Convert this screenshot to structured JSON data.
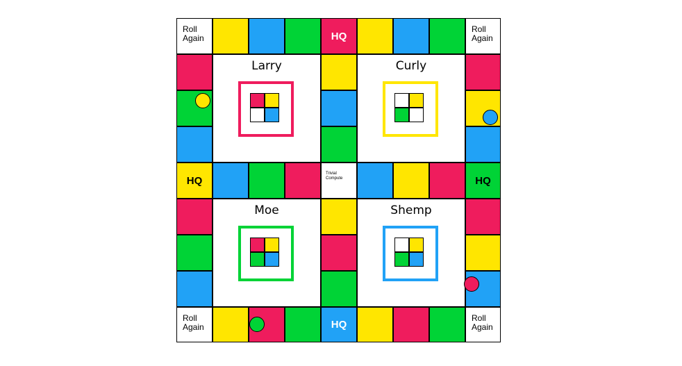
{
  "board": {
    "roll_again_label": "Roll\nAgain",
    "hq_label": "HQ",
    "center_label": "Trivial\nCompute",
    "colors": {
      "red": "#ef1c5d",
      "yellow": "#ffe600",
      "blue": "#21a2f6",
      "green": "#00d336"
    },
    "top_row": [
      "roll-again",
      "yellow",
      "blue",
      "green",
      "hq-red",
      "yellow",
      "blue",
      "green",
      "roll-again"
    ],
    "middle_row": [
      "hq-yellow",
      "blue",
      "green",
      "red",
      "trivial-compute",
      "blue",
      "yellow",
      "red",
      "hq-green"
    ],
    "bottom_row": [
      "roll-again",
      "yellow",
      "red",
      "green",
      "hq-blue",
      "yellow",
      "red",
      "green",
      "roll-again"
    ],
    "left_column_upper": [
      "red",
      "green",
      "blue"
    ],
    "left_column_lower": [
      "red",
      "green",
      "blue"
    ],
    "center_column_upper": [
      "yellow",
      "blue",
      "green"
    ],
    "center_column_lower": [
      "yellow",
      "red",
      "green"
    ],
    "right_column_upper": [
      "red",
      "yellow",
      "blue"
    ],
    "right_column_lower": [
      "red",
      "yellow",
      "blue"
    ]
  },
  "players": [
    {
      "name": "Larry",
      "color": "#ef1c5d",
      "wedges": [
        "red",
        "yellow",
        "white",
        "blue"
      ]
    },
    {
      "name": "Curly",
      "color": "#ffe600",
      "wedges": [
        "white",
        "yellow",
        "green",
        "white"
      ]
    },
    {
      "name": "Moe",
      "color": "#00d336",
      "wedges": [
        "red",
        "yellow",
        "green",
        "blue"
      ]
    },
    {
      "name": "Shemp",
      "color": "#21a2f6",
      "wedges": [
        "white",
        "yellow",
        "green",
        "blue"
      ]
    }
  ],
  "tokens": [
    {
      "player": "Larry",
      "color": "#ef1c5d"
    },
    {
      "player": "Curly",
      "color": "#ffe600"
    },
    {
      "player": "Moe",
      "color": "#00d336"
    },
    {
      "player": "Shemp",
      "color": "#21a2f6"
    }
  ]
}
